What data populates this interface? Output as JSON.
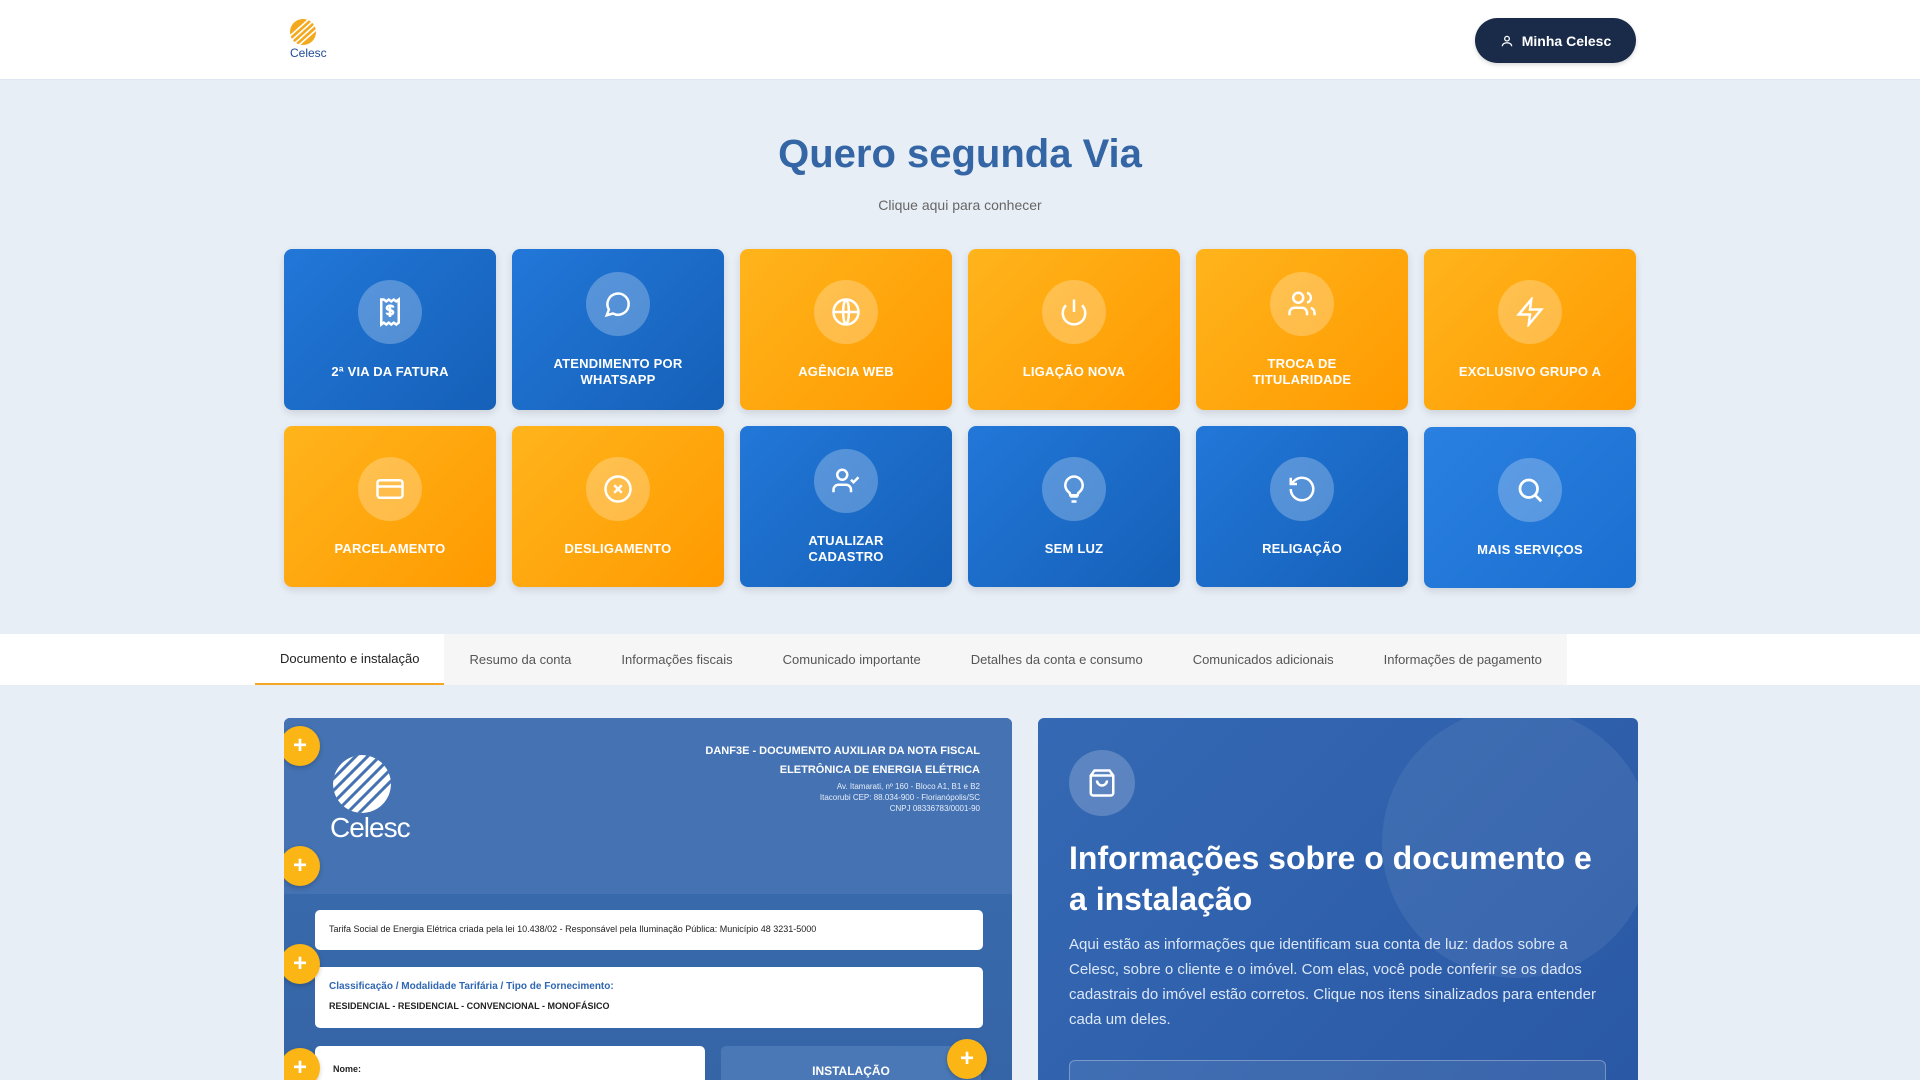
{
  "header": {
    "logo_text": "Celesc",
    "account_button": "Minha Celesc"
  },
  "hero": {
    "title": "Quero segunda Via",
    "subtitle": "Clique aqui para conhecer"
  },
  "tiles": [
    {
      "label": "2ª VIA DA FATURA",
      "color": "blue",
      "icon": "receipt-dollar-icon"
    },
    {
      "label": "ATENDIMENTO POR WHATSAPP",
      "color": "blue",
      "icon": "chat-bubble-icon"
    },
    {
      "label": "AGÊNCIA WEB",
      "color": "orange",
      "icon": "globe-icon"
    },
    {
      "label": "LIGAÇÃO NOVA",
      "color": "orange",
      "icon": "power-icon"
    },
    {
      "label": "TROCA DE TITULARIDADE",
      "color": "orange",
      "icon": "users-icon"
    },
    {
      "label": "EXCLUSIVO GRUPO A",
      "color": "orange",
      "icon": "lightning-icon"
    },
    {
      "label": "PARCELAMENTO",
      "color": "orange",
      "icon": "credit-card-icon"
    },
    {
      "label": "DESLIGAMENTO",
      "color": "orange",
      "icon": "circle-x-icon"
    },
    {
      "label": "ATUALIZAR CADASTRO",
      "color": "blue",
      "icon": "user-check-icon"
    },
    {
      "label": "SEM LUZ",
      "color": "blue",
      "icon": "lightbulb-icon"
    },
    {
      "label": "RELIGAÇÃO",
      "color": "blue",
      "icon": "refresh-icon"
    },
    {
      "label": "MAIS SERVIÇOS",
      "color": "blue",
      "icon": "search-icon"
    }
  ],
  "tabs": [
    {
      "label": "Documento e instalação",
      "active": true
    },
    {
      "label": "Resumo da conta"
    },
    {
      "label": "Informações fiscais"
    },
    {
      "label": "Comunicado importante"
    },
    {
      "label": "Detalhes da conta e consumo"
    },
    {
      "label": "Comunicados adicionais"
    },
    {
      "label": "Informações de pagamento"
    }
  ],
  "document": {
    "logo_text": "Celesc",
    "heading": "DANF3E - DOCUMENTO AUXILIAR DA NOTA FISCAL ELETRÔNICA DE ENERGIA ELÉTRICA",
    "address_line1": "Av. Itamarati, nº 160 - Bloco A1, B1 e B2",
    "address_line2": "Itacorubi CEP: 88.034-900 - Florianópolis/SC",
    "address_line3": "CNPJ 08336783/0001-90",
    "tariff_note": "Tarifa Social de Energia Elétrica criada pela lei 10.438/02 - Responsável pela Iluminação Pública: Município 48 3231-5000",
    "classification_label": "Classificação / Modalidade Tarifária / Tipo de Fornecimento:",
    "classification_value": "RESIDENCIAL - RESIDENCIAL - CONVENCIONAL - MONOFÁSICO",
    "name_label": "Nome:",
    "installation_label": "INSTALAÇÃO",
    "plus_symbol": "+"
  },
  "info": {
    "title": "Informações sobre o documento e a instalação",
    "body": "Aqui estão as informações que identificam sua conta de luz: dados sobre a Celesc, sobre o cliente e o imóvel. Com elas, você pode conferir se os dados cadastrais do imóvel estão corretos. Clique nos itens sinalizados para entender cada um deles."
  },
  "colors": {
    "brand_dark": "#1a2b4a",
    "title_blue": "#3465a4",
    "tile_blue": "#1b6fd0",
    "tile_orange": "#ffa80e",
    "accent_yellow": "#fbb514"
  }
}
